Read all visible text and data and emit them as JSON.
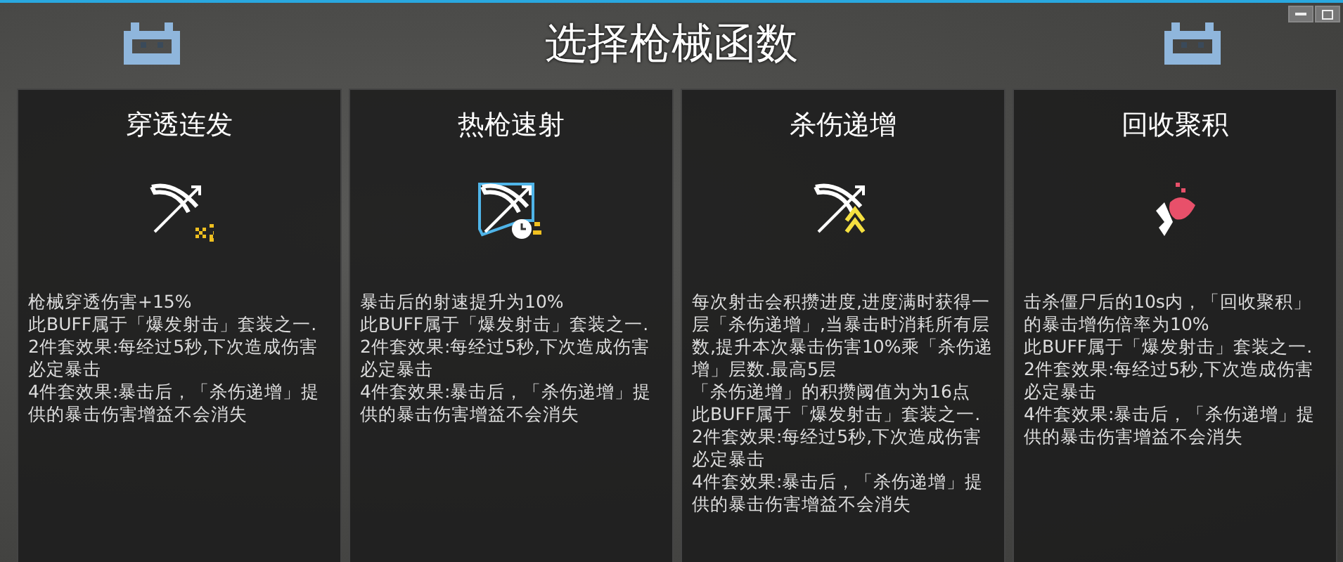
{
  "window": {
    "title": "选择枪械函数"
  },
  "cards": [
    {
      "title": "穿透连发",
      "description": [
        "枪械穿透伤害+15%",
        "此BUFF属于「爆发射击」套装之一.",
        "2件套效果:每经过5秒,下次造成伤害必定暴击",
        "4件套效果:暴击后，「杀伤递增」提供的暴击伤害增益不会消失"
      ]
    },
    {
      "title": "热枪速射",
      "description": [
        "暴击后的射速提升为10%",
        "此BUFF属于「爆发射击」套装之一.",
        "2件套效果:每经过5秒,下次造成伤害必定暴击",
        "4件套效果:暴击后，「杀伤递增」提供的暴击伤害增益不会消失"
      ]
    },
    {
      "title": "杀伤递增",
      "description": [
        "每次射击会积攒进度,进度满时获得一层「杀伤递增」,当暴击时消耗所有层数,提升本次暴击伤害10%乘「杀伤递增」层数.最高5层",
        "「杀伤递增」的积攒阈值为为16点",
        "此BUFF属于「爆发射击」套装之一.",
        "2件套效果:每经过5秒,下次造成伤害必定暴击",
        "4件套效果:暴击后，「杀伤递增」提供的暴击伤害增益不会消失"
      ]
    },
    {
      "title": "回收聚积",
      "description": [
        "击杀僵尸后的10s内，「回收聚积」的暴击增伤倍率为10%",
        "此BUFF属于「爆发射击」套装之一.",
        "2件套效果:每经过5秒,下次造成伤害必定暴击",
        "4件套效果:暴击后，「杀伤递增」提供的暴击伤害增益不会消失"
      ]
    }
  ]
}
